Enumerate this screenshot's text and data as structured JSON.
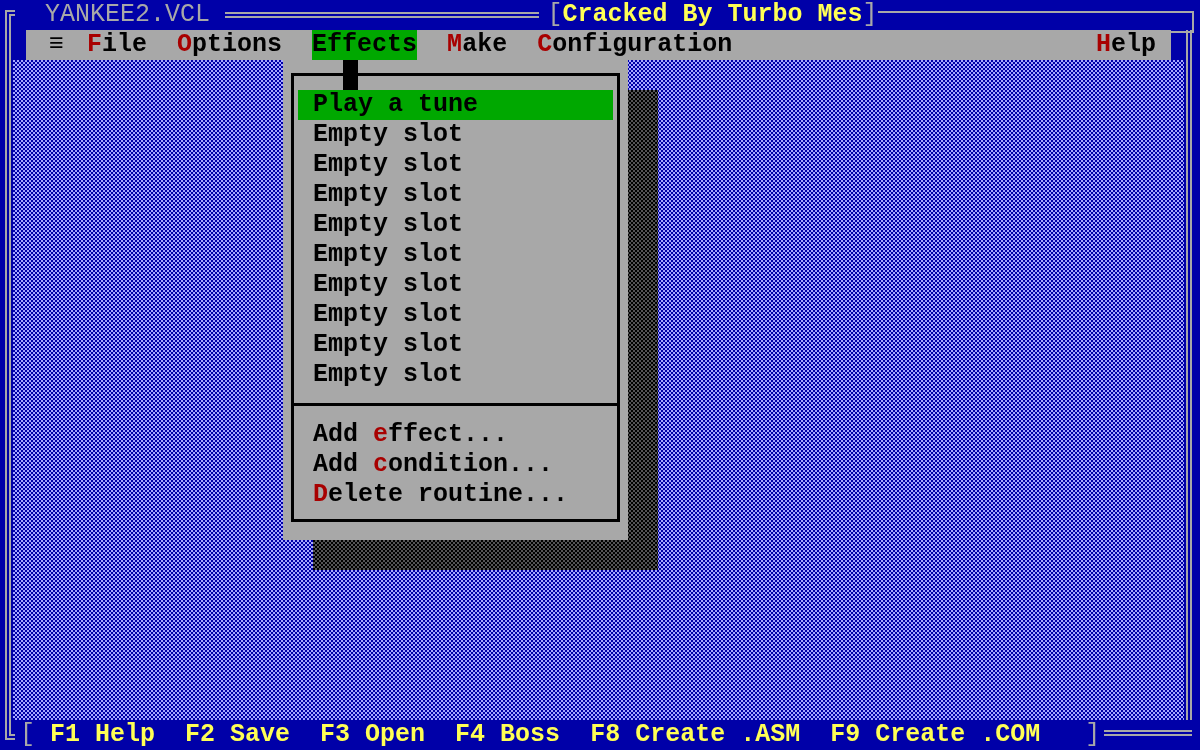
{
  "window": {
    "title": "YANKEE2.VCL",
    "banner_open": "[",
    "banner": "Cracked By Turbo Mes",
    "banner_close": "]"
  },
  "menu_bar": {
    "system_menu": "≡",
    "items": [
      {
        "hotkey": "F",
        "rest": "ile",
        "selected": false
      },
      {
        "hotkey": "O",
        "rest": "ptions",
        "selected": false
      },
      {
        "hotkey": "E",
        "rest": "ffects",
        "selected": true
      },
      {
        "hotkey": "M",
        "rest": "ake",
        "selected": false
      },
      {
        "hotkey": "C",
        "rest": "onfiguration",
        "selected": false
      },
      {
        "hotkey": "H",
        "rest": "elp",
        "selected": false
      }
    ]
  },
  "dropdown": {
    "slots": [
      {
        "label": "Play a tune",
        "selected": true
      },
      {
        "label": "Empty slot",
        "selected": false
      },
      {
        "label": "Empty slot",
        "selected": false
      },
      {
        "label": "Empty slot",
        "selected": false
      },
      {
        "label": "Empty slot",
        "selected": false
      },
      {
        "label": "Empty slot",
        "selected": false
      },
      {
        "label": "Empty slot",
        "selected": false
      },
      {
        "label": "Empty slot",
        "selected": false
      },
      {
        "label": "Empty slot",
        "selected": false
      },
      {
        "label": "Empty slot",
        "selected": false
      }
    ],
    "actions": [
      {
        "before": "Add ",
        "hotkey": "e",
        "after": "ffect...",
        "selected": false
      },
      {
        "before": "Add ",
        "hotkey": "c",
        "after": "ondition...",
        "selected": false
      },
      {
        "hotkey": "D",
        "after": "elete routine...",
        "selected": false
      }
    ]
  },
  "status_bar": {
    "open": "[",
    "close": "]",
    "keys": [
      "F1 Help",
      "F2 Save",
      "F3 Open",
      "F4 Boss",
      "F8 Create .ASM",
      "F9 Create .COM"
    ]
  }
}
